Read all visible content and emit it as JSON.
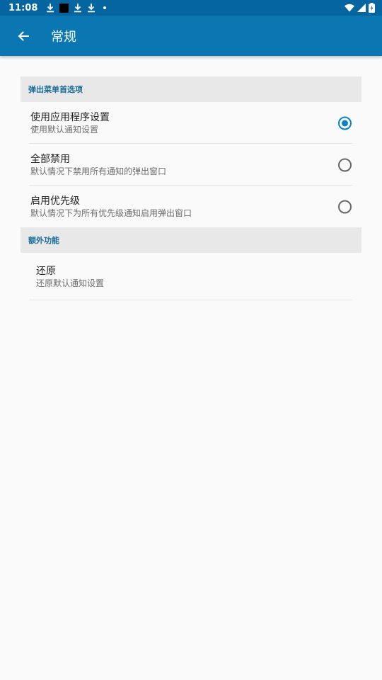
{
  "status_bar": {
    "time": "11:08",
    "icons_left": [
      "download-icon",
      "black-square-icon",
      "download-icon",
      "download-icon",
      "dot-icon"
    ],
    "icons_right": [
      "wifi-icon",
      "signal-icon",
      "battery-charging-icon"
    ]
  },
  "app_bar": {
    "back_icon": "arrow-left-icon",
    "title": "常规",
    "color": "#0a77b2"
  },
  "sections": {
    "popup": {
      "header": "弹出菜单首选项",
      "options": [
        {
          "title": "使用应用程序设置",
          "subtitle": "使用默认通知设置",
          "selected": true
        },
        {
          "title": "全部禁用",
          "subtitle": "默认情况下禁用所有通知的弹出窗口",
          "selected": false
        },
        {
          "title": "启用优先级",
          "subtitle": "默认情况下为所有优先级通知启用弹出窗口",
          "selected": false
        }
      ]
    },
    "extra": {
      "header": "额外功能",
      "restore": {
        "title": "还原",
        "subtitle": "还原默认通知设置"
      }
    }
  },
  "colors": {
    "accent": "#0a83c5",
    "status_bar": "#0565a0",
    "background": "#fafafa"
  }
}
